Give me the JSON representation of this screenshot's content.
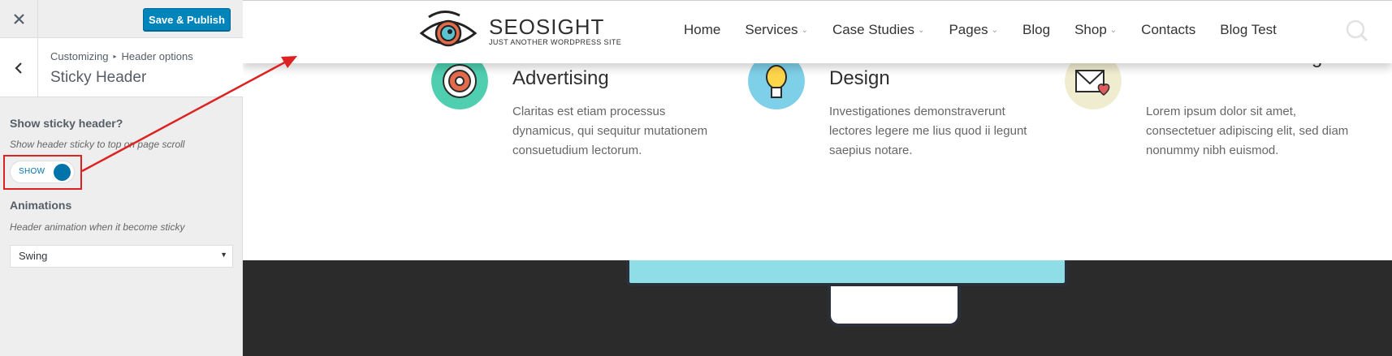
{
  "sidebar": {
    "publish_label": "Save & Publish",
    "breadcrumb": {
      "root": "Customizing",
      "section": "Header options"
    },
    "section_title": "Sticky Header",
    "sticky": {
      "title": "Show sticky header?",
      "description": "Show header sticky to top on page scroll",
      "toggle_label": "SHOW",
      "enabled": true
    },
    "animations": {
      "title": "Animations",
      "description": "Header animation when it become sticky",
      "selected": "Swing"
    }
  },
  "site": {
    "logo_title": "SEOSIGHT",
    "logo_tagline": "JUST ANOTHER WORDPRESS SITE",
    "nav": [
      {
        "label": "Home",
        "dropdown": false
      },
      {
        "label": "Services",
        "dropdown": true
      },
      {
        "label": "Case Studies",
        "dropdown": true
      },
      {
        "label": "Pages",
        "dropdown": true
      },
      {
        "label": "Blog",
        "dropdown": false
      },
      {
        "label": "Shop",
        "dropdown": true
      },
      {
        "label": "Contacts",
        "dropdown": false
      },
      {
        "label": "Blog Test",
        "dropdown": false
      }
    ],
    "dropdown_glyph": "⌄",
    "features": [
      {
        "title": "Paid Search Advertising",
        "text": "Claritas est etiam processus dynamicus, qui sequitur mutationem consuetudium lectorum.",
        "icon": "target-icon",
        "icon_color": "#4fcfb0"
      },
      {
        "title": "Custom Website Design",
        "text": "Investigationes demonstraverunt lectores legere me lius quod ii legunt saepius notare.",
        "icon": "lightbulb-icon",
        "icon_color": "#7ecfe8"
      },
      {
        "title": "Custom Email Design",
        "text": "Lorem ipsum dolor sit amet, consectetuer adipiscing elit, sed diam nonummy nibh euismod.",
        "icon": "envelope-heart-icon",
        "icon_color": "#f0ecd0"
      }
    ]
  },
  "colors": {
    "accent": "#0073aa",
    "publish": "#0085ba",
    "highlight": "#dd2222",
    "dark_band": "#2b2b2b"
  }
}
